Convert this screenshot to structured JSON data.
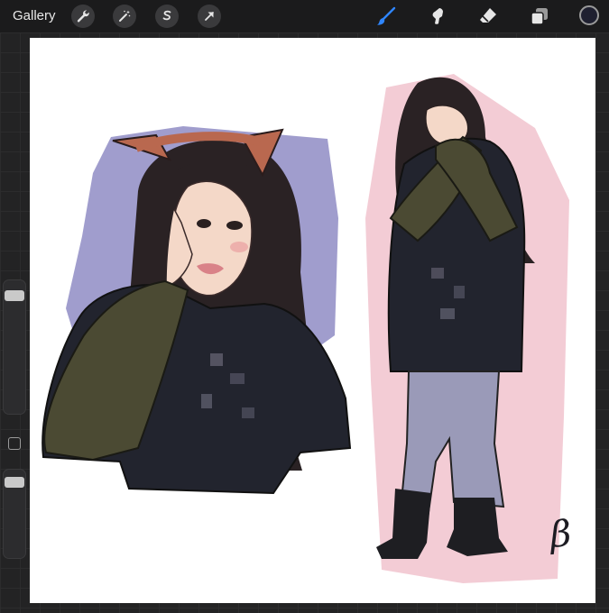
{
  "toolbar": {
    "gallery_label": "Gallery",
    "left_tools": [
      "wrench-icon",
      "magic-wand-icon",
      "selection-icon",
      "transform-arrow-icon"
    ],
    "right_tools": [
      "brush-icon",
      "smudge-icon",
      "eraser-icon",
      "layers-icon"
    ],
    "active_tool": "brush-icon",
    "current_color": "#1f2030",
    "accent_color": "#2f86ff"
  },
  "sidebar": {
    "brush_size_level": 0.95,
    "opacity_level": 0.95
  },
  "canvas": {
    "background": "#ffffff",
    "signature": "β"
  }
}
